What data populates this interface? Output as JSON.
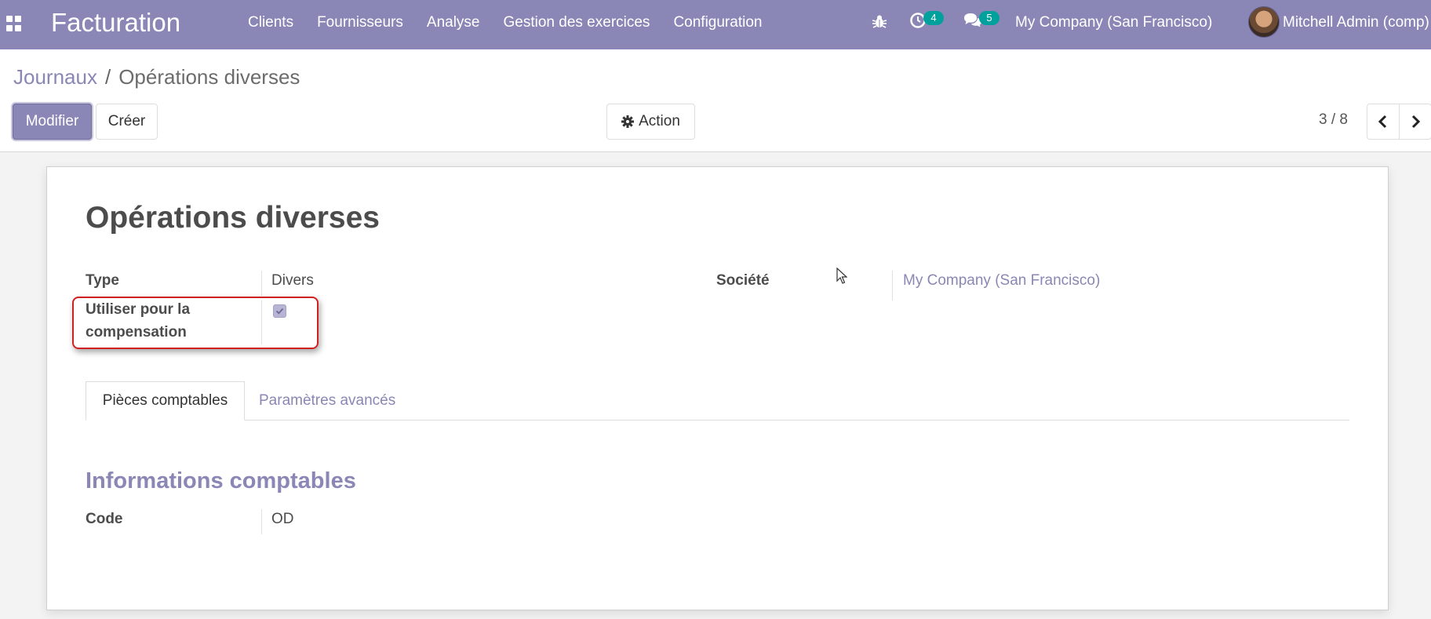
{
  "navbar": {
    "app_name": "Facturation",
    "menu": [
      "Clients",
      "Fournisseurs",
      "Analyse",
      "Gestion des exercices",
      "Configuration"
    ],
    "activities_count": "4",
    "messages_count": "5",
    "company": "My Company (San Francisco)",
    "user": "Mitchell Admin (comp)",
    "icons": [
      "apps-icon",
      "bug-icon",
      "clock-icon",
      "chat-icon"
    ]
  },
  "control": {
    "breadcrumb_parent": "Journaux",
    "breadcrumb_separator": "/",
    "breadcrumb_current": "Opérations diverses",
    "edit_label": "Modifier",
    "create_label": "Créer",
    "action_label": "Action",
    "pager": "3 / 8"
  },
  "form": {
    "title": "Opérations diverses",
    "type_label": "Type",
    "type_value": "Divers",
    "compensation_label_line1": "Utiliser pour la",
    "compensation_label_line2": "compensation",
    "compensation_checked": true,
    "company_label": "Société",
    "company_value": "My Company (San Francisco)",
    "tabs": [
      "Pièces comptables",
      "Paramètres avancés"
    ],
    "active_tab": "Pièces comptables",
    "section_title": "Informations comptables",
    "code_label": "Code",
    "code_value": "OD"
  },
  "colors": {
    "brand": "#8a86b5",
    "badge": "#00a09d",
    "highlight": "#d02020"
  }
}
